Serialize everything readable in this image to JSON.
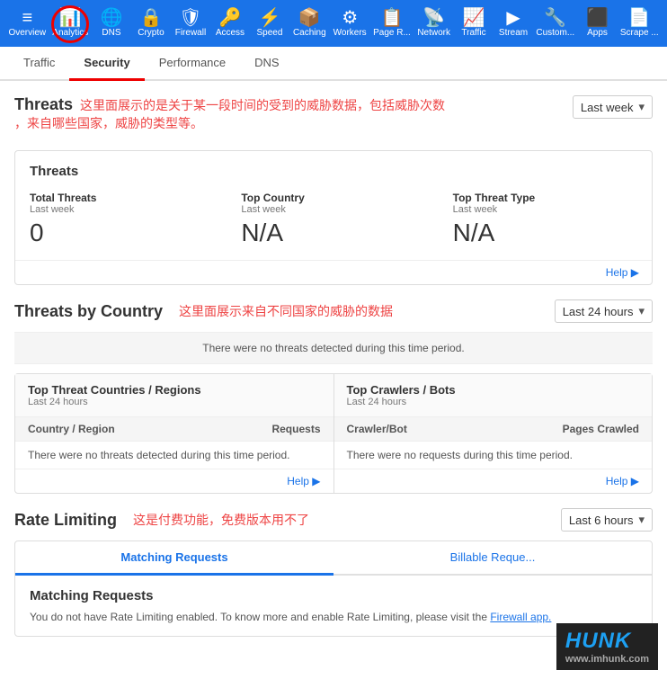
{
  "topNav": {
    "items": [
      {
        "label": "Overview",
        "icon": "≡",
        "id": "overview"
      },
      {
        "label": "Analytics",
        "icon": "📊",
        "id": "analytics",
        "active": true
      },
      {
        "label": "DNS",
        "icon": "🌐",
        "id": "dns"
      },
      {
        "label": "Crypto",
        "icon": "🔒",
        "id": "crypto"
      },
      {
        "label": "Firewall",
        "icon": "🛡",
        "id": "firewall"
      },
      {
        "label": "Access",
        "icon": "🔑",
        "id": "access"
      },
      {
        "label": "Speed",
        "icon": "⚡",
        "id": "speed"
      },
      {
        "label": "Caching",
        "icon": "📦",
        "id": "caching"
      },
      {
        "label": "Workers",
        "icon": "⚙",
        "id": "workers"
      },
      {
        "label": "Page R...",
        "icon": "📋",
        "id": "pagerules"
      },
      {
        "label": "Network",
        "icon": "📡",
        "id": "network"
      },
      {
        "label": "Traffic",
        "icon": "📈",
        "id": "traffic"
      },
      {
        "label": "Stream",
        "icon": "▶",
        "id": "stream"
      },
      {
        "label": "Custom...",
        "icon": "🔧",
        "id": "custom"
      },
      {
        "label": "Apps",
        "icon": "⬛",
        "id": "apps"
      },
      {
        "label": "Scrape ...",
        "icon": "📄",
        "id": "scrape"
      }
    ]
  },
  "secondNav": {
    "items": [
      {
        "label": "Traffic",
        "id": "traffic"
      },
      {
        "label": "Security",
        "id": "security",
        "active": true
      },
      {
        "label": "Performance",
        "id": "performance"
      },
      {
        "label": "DNS",
        "id": "dns"
      }
    ]
  },
  "threats": {
    "sectionTitle": "Threats",
    "annotation1": "这里面展示的是关于某一段时间的受到的威胁数据，包括威胁次数",
    "annotation2": "，来自哪些国家，威胁的类型等。",
    "dropdown": "Last week",
    "card": {
      "title": "Threats",
      "stats": [
        {
          "label": "Total Threats",
          "period": "Last week",
          "value": "0"
        },
        {
          "label": "Top Country",
          "period": "Last week",
          "value": "N/A"
        },
        {
          "label": "Top Threat Type",
          "period": "Last week",
          "value": "N/A"
        }
      ]
    },
    "helpLabel": "Help ▶"
  },
  "threatsByCountry": {
    "sectionTitle": "Threats by Country",
    "annotation": "这里面展示来自不同国家的威胁的数据",
    "dropdown": "Last 24 hours",
    "alertMessage": "There were no threats detected during this time period.",
    "leftPanel": {
      "title": "Top Threat Countries / Regions",
      "period": "Last 24 hours",
      "colHeaders": [
        "Country / Region",
        "Requests"
      ],
      "emptyMessage": "There were no threats detected during this time period.",
      "helpLabel": "Help ▶"
    },
    "rightPanel": {
      "title": "Top Crawlers / Bots",
      "period": "Last 24 hours",
      "colHeaders": [
        "Crawler/Bot",
        "Pages Crawled"
      ],
      "emptyMessage": "There were no requests during this time period.",
      "helpLabel": "Help ▶"
    }
  },
  "rateLimiting": {
    "sectionTitle": "Rate Limiting",
    "annotation": "这是付费功能，免费版本用不了",
    "dropdown": "Last 6 hours",
    "tabs": [
      {
        "label": "Matching Requests",
        "id": "matching",
        "active": true
      },
      {
        "label": "Billable Reque...",
        "id": "billable"
      }
    ],
    "cardTitle": "Matching Requests",
    "cardText": "You do not have Rate Limiting enabled. To know more and enable Rate Limiting, please visit the",
    "cardLink": "Firewall app.",
    "watermark": {
      "brand": "HUNK",
      "url": "www.imhunk.com"
    }
  }
}
